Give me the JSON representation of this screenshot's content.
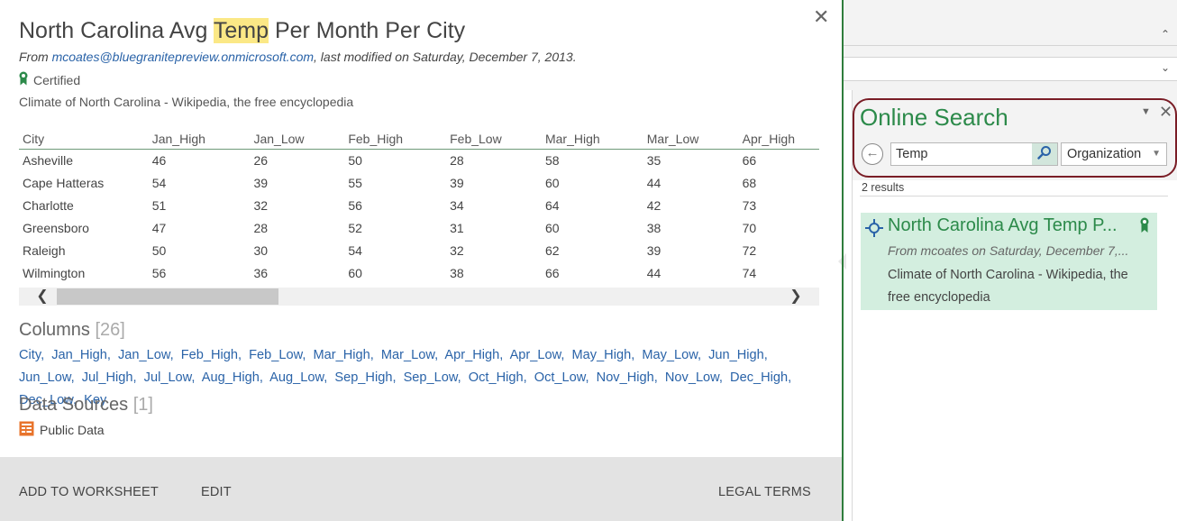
{
  "preview": {
    "title_before": "North Carolina Avg ",
    "title_highlight": "Temp",
    "title_after": " Per Month Per City",
    "meta_prefix": "From ",
    "meta_author": "mcoates@bluegranitepreview.onmicrosoft.com",
    "meta_suffix": ", last modified on Saturday, December 7, 2013.",
    "certified_label": "Certified",
    "description": "Climate of North Carolina - Wikipedia, the free encyclopedia",
    "close_glyph": "✕"
  },
  "table": {
    "headers": [
      "City",
      "Jan_High",
      "Jan_Low",
      "Feb_High",
      "Feb_Low",
      "Mar_High",
      "Mar_Low",
      "Apr_High"
    ],
    "rows": [
      [
        "Asheville",
        "46",
        "26",
        "50",
        "28",
        "58",
        "35",
        "66"
      ],
      [
        "Cape Hatteras",
        "54",
        "39",
        "55",
        "39",
        "60",
        "44",
        "68"
      ],
      [
        "Charlotte",
        "51",
        "32",
        "56",
        "34",
        "64",
        "42",
        "73"
      ],
      [
        "Greensboro",
        "47",
        "28",
        "52",
        "31",
        "60",
        "38",
        "70"
      ],
      [
        "Raleigh",
        "50",
        "30",
        "54",
        "32",
        "62",
        "39",
        "72"
      ],
      [
        "Wilmington",
        "56",
        "36",
        "60",
        "38",
        "66",
        "44",
        "74"
      ]
    ]
  },
  "columns_section": {
    "label": "Columns ",
    "count": "[26]",
    "items": [
      "City",
      "Jan_High",
      "Jan_Low",
      "Feb_High",
      "Feb_Low",
      "Mar_High",
      "Mar_Low",
      "Apr_High",
      "Apr_Low",
      "May_High",
      "May_Low",
      "Jun_High",
      "Jun_Low",
      "Jul_High",
      "Jul_Low",
      "Aug_High",
      "Aug_Low",
      "Sep_High",
      "Sep_Low",
      "Oct_High",
      "Oct_Low",
      "Nov_High",
      "Nov_Low",
      "Dec_High",
      "Dec_Low",
      "Key"
    ]
  },
  "data_sources_section": {
    "label": "Data Sources ",
    "count": "[1]",
    "item": "Public Data"
  },
  "footer": {
    "add_to_worksheet": "ADD TO WORKSHEET",
    "edit": "EDIT",
    "legal_terms": "LEGAL TERMS"
  },
  "pane": {
    "title": "Online Search",
    "search_value": "Temp",
    "scope": "Organization",
    "results_count": "2 results",
    "result": {
      "title": "North Carolina Avg Temp P...",
      "meta": "From mcoates on Saturday, December 7,...",
      "description": "Climate of North Carolina - Wikipedia, the free encyclopedia"
    }
  },
  "colors": {
    "accent_green": "#2c8a4a",
    "highlight_yellow": "#fbe886",
    "link_blue": "#2a63a8",
    "search_outline": "#7a1d26",
    "result_bg": "#d3eedf"
  }
}
